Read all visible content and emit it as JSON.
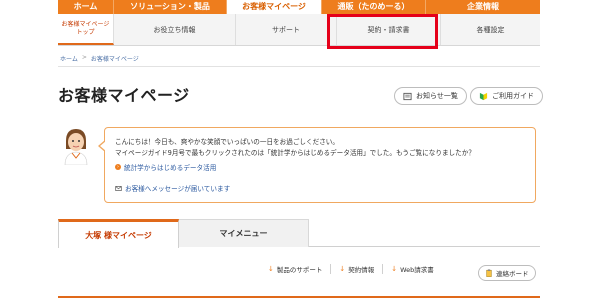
{
  "top_nav": {
    "items": [
      {
        "label": "ホーム"
      },
      {
        "label": "ソリューション・製品"
      },
      {
        "label": "お客様マイページ"
      },
      {
        "label": "通販（たのめーる）"
      },
      {
        "label": "企業情報"
      }
    ]
  },
  "sub_nav": {
    "items": [
      {
        "label_line1": "お客様マイページ",
        "label_line2": "トップ"
      },
      {
        "label": "お役立ち情報"
      },
      {
        "label": "サポート"
      },
      {
        "label": "契約・請求書"
      },
      {
        "label": "各種設定"
      }
    ]
  },
  "breadcrumb": {
    "home": "ホーム",
    "sep": ">",
    "current": "お客様マイページ"
  },
  "page": {
    "title": "お客様マイページ"
  },
  "buttons": {
    "news": "お知らせ一覧",
    "guide": "ご利用ガイド",
    "contact": "連絡ボード"
  },
  "message": {
    "line1": "こんにちは！今日も、爽やかな笑顔でいっぱいの一日をお過ごしください。",
    "line2": "マイページガイド9月号で最もクリックされたのは「統計学からはじめるデータ活用」でした。もうご覧になりましたか？",
    "link1": "統計学からはじめるデータ活用",
    "link2": "お客様へメッセージが届いています"
  },
  "tabs": {
    "active": "大塚 様マイページ",
    "inactive": "マイメニュー"
  },
  "links": {
    "support": "製品のサポート",
    "contract": "契約情報",
    "web_invoice": "Web請求書"
  },
  "colors": {
    "accent": "#ee7d1d",
    "highlight": "#e5001a",
    "link": "#2c5aa0"
  }
}
